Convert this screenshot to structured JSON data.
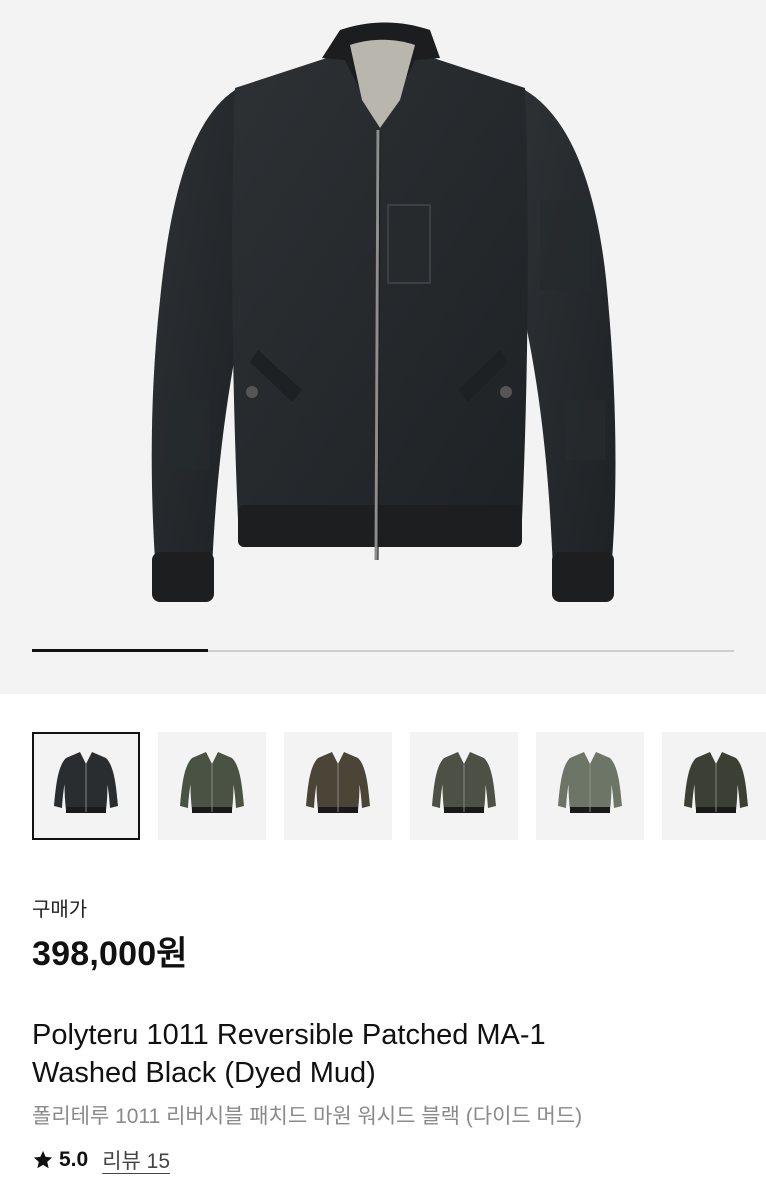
{
  "product": {
    "image_index": 1,
    "image_count": 4,
    "thumbnails": [
      {
        "name": "thumb-washed-black",
        "color": "#2a2d30",
        "selected": true
      },
      {
        "name": "thumb-olive-1",
        "color": "#4a5243",
        "selected": false
      },
      {
        "name": "thumb-mud-brown",
        "color": "#4a4537",
        "selected": false
      },
      {
        "name": "thumb-olive-2",
        "color": "#4d5045",
        "selected": false
      },
      {
        "name": "thumb-sage",
        "color": "#6c7566",
        "selected": false
      },
      {
        "name": "thumb-dark-olive",
        "color": "#3c3f33",
        "selected": false
      }
    ],
    "price_label": "구매가",
    "price": "398,000원",
    "title_en_line1": "Polyteru 1011 Reversible Patched MA-1",
    "title_en_line2": "Washed Black (Dyed Mud)",
    "title_ko": "폴리테루 1011 리버시블 패치드 마원 워시드 블랙 (다이드 머드)",
    "rating": "5.0",
    "reviews_label": "리뷰 15"
  },
  "colors": {
    "accent": "#111111",
    "muted_text": "#8a8a8a",
    "image_bg": "#f3f3f3"
  }
}
